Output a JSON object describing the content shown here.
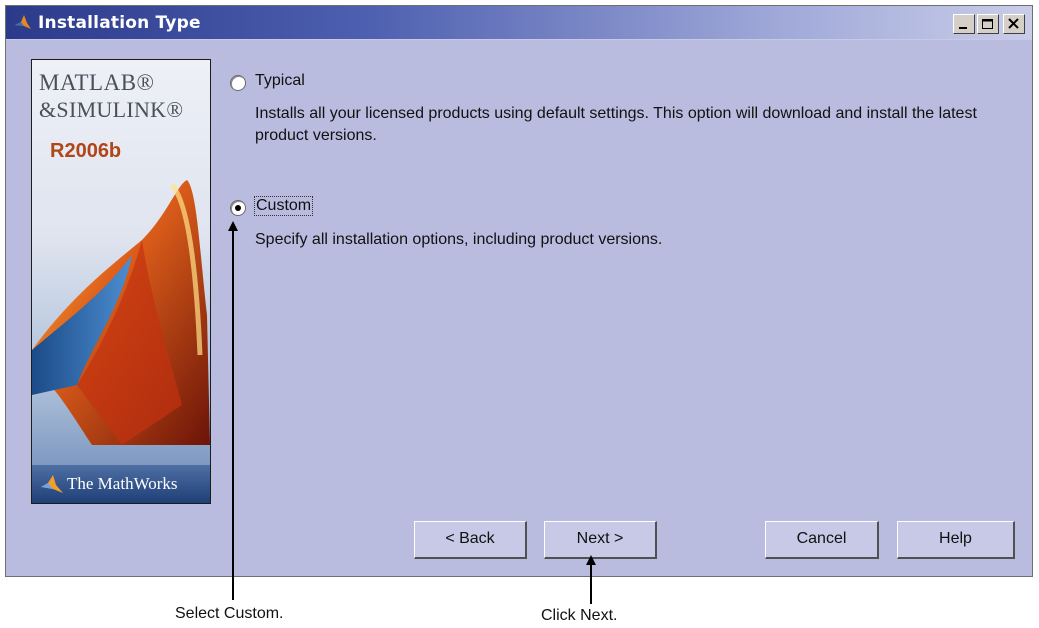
{
  "window": {
    "title": "Installation Type",
    "controls": {
      "minimize_icon": "minimize-icon",
      "maximize_icon": "maximize-icon",
      "close_icon": "close-icon"
    }
  },
  "banner": {
    "logo_line1": "MATLAB®",
    "logo_line2": "&SIMULINK®",
    "release": "R2006b",
    "footer_text": "The MathWorks"
  },
  "options": [
    {
      "label": "Typical",
      "selected": false,
      "description": "Installs all your licensed products using default settings.  This option will download and install the latest product versions."
    },
    {
      "label": "Custom",
      "selected": true,
      "description": "Specify all installation options, including product versions."
    }
  ],
  "buttons": {
    "back": "< Back",
    "next": "Next >",
    "cancel": "Cancel",
    "help": "Help"
  },
  "callouts": {
    "custom": "Select Custom.",
    "next": "Click Next."
  },
  "colors": {
    "panel": "#b9bcdf",
    "title_start": "#2c3a8a",
    "title_end": "#c9cde9"
  }
}
